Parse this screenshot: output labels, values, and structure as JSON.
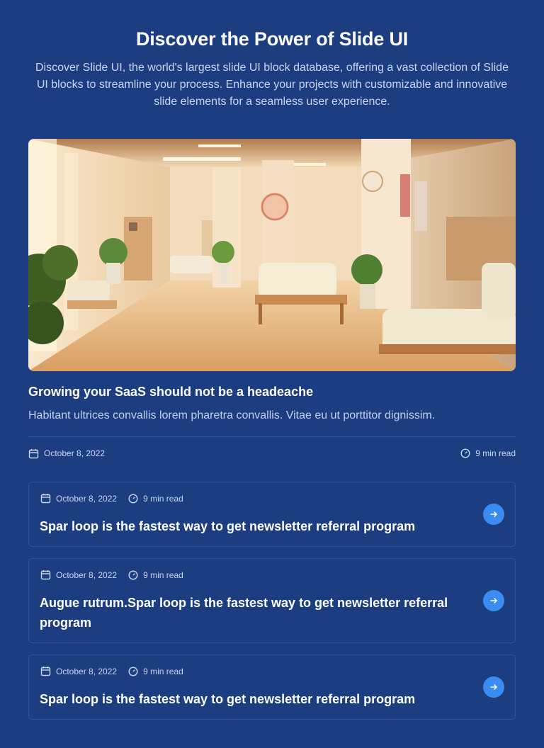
{
  "hero": {
    "title": "Discover the Power of Slide UI",
    "description": "Discover Slide UI, the world's largest slide UI block database, offering a vast collection of Slide UI blocks to streamline your process. Enhance your projects with customizable and innovative slide elements for a seamless user experience."
  },
  "featured": {
    "image_subject": "hospital-corridor-image",
    "title": "Growing your SaaS should not be a headeache",
    "excerpt": "Habitant ultrices convallis lorem pharetra convallis. Vitae eu ut porttitor dignissim.",
    "date": "October 8, 2022",
    "read_time": "9 min read"
  },
  "cards": [
    {
      "date": "October 8, 2022",
      "read_time": "9 min read",
      "title": "Spar loop is the fastest way to get newsletter referral program"
    },
    {
      "date": "October 8, 2022",
      "read_time": "9 min read",
      "title": "Augue rutrum.Spar loop is the fastest way to get newsletter referral program"
    },
    {
      "date": "October 8, 2022",
      "read_time": "9 min read",
      "title": "Spar loop is the fastest way to get newsletter referral program"
    }
  ],
  "colors": {
    "background": "#1c3d7f",
    "accent": "#3b8cf2",
    "border": "#2f5497",
    "muted_text": "#c9d7f3"
  },
  "icons": {
    "date": "calendar-icon",
    "read_time": "clock-icon",
    "card_action": "arrow-right-icon"
  }
}
